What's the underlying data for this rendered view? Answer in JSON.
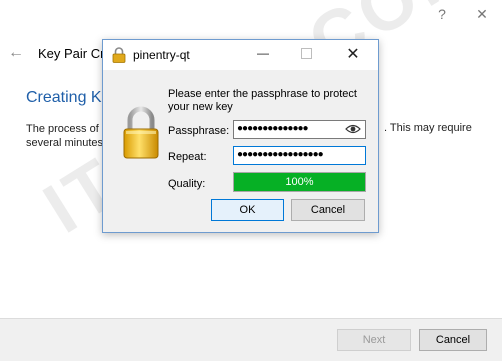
{
  "window": {
    "controls": {
      "help": "?",
      "close": "✕"
    },
    "back_icon": "back-arrow-icon",
    "wizard_title": "Key Pair Crea",
    "heading": "Creating Ke",
    "body_left": "The process of several minutes",
    "body_right": ". This may require",
    "footer": {
      "next_label": "Next",
      "cancel_label": "Cancel"
    }
  },
  "watermark": "ITNOTE.COM",
  "dialog": {
    "title": "pinentry-qt",
    "title_icon": "padlock-icon",
    "window_buttons": {
      "minimize": "—",
      "close": "✕"
    },
    "prompt": "Please enter the passphrase to protect your new key",
    "passphrase_label": "Passphrase:",
    "passphrase_value": "●●●●●●●●●●●●●●",
    "repeat_label": "Repeat:",
    "repeat_value": "●●●●●●●●●●●●●●●●●",
    "quality_label": "Quality:",
    "quality_value": "100%",
    "quality_fraction": 1.0,
    "ok_label": "OK",
    "cancel_label": "Cancel",
    "colors": {
      "quality_bar": "#06b025",
      "focus_border": "#0078d7",
      "heading": "#1f5fa9"
    }
  }
}
